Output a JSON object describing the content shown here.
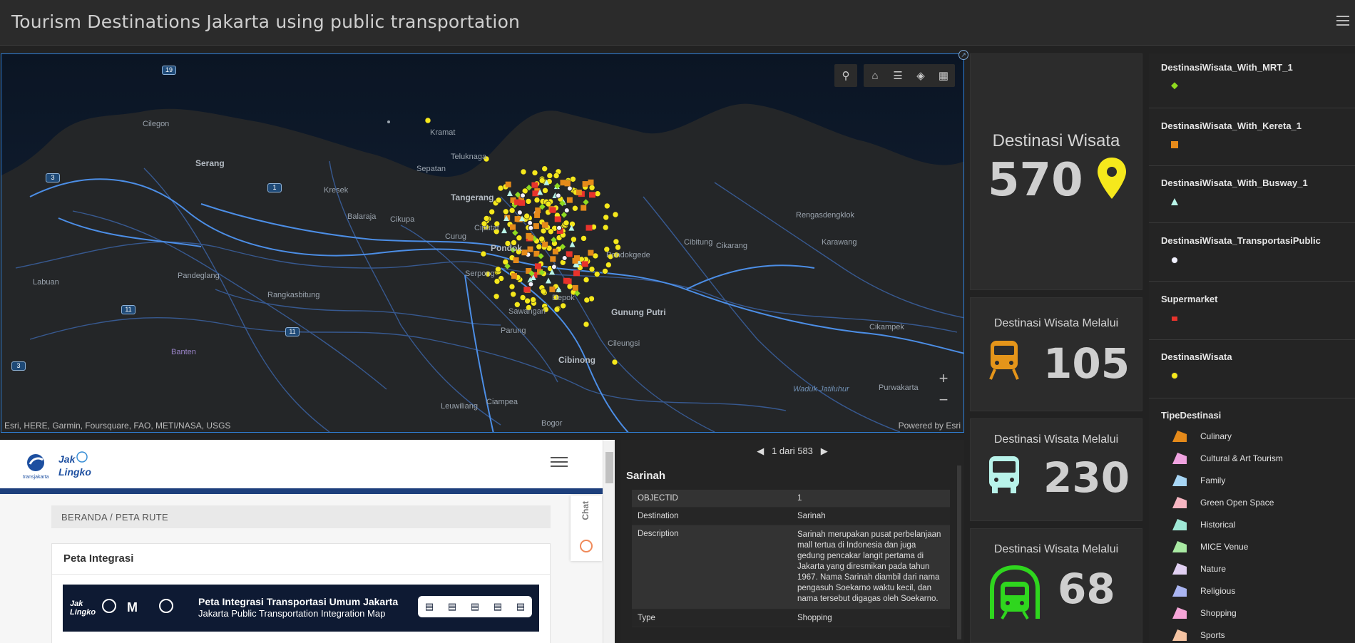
{
  "header": {
    "title": "Tourism Destinations Jakarta using public transportation"
  },
  "map": {
    "attribution": "Esri, HERE, Garmin, Foursquare, FAO, METI/NASA, USGS",
    "powered_by": "Powered by Esri",
    "labels": {
      "cilegon": "Cilegon",
      "serang": "Serang",
      "kramat": "Kramat",
      "sepatan": "Sepatan",
      "teluknaga": "Teluknaga",
      "tangerang": "Tangerang",
      "kresek": "Kresek",
      "balaraja": "Balaraja",
      "cikupa": "Cikupa",
      "curug": "Curug",
      "ciputat": "Ciputat",
      "pondok": "Pondok",
      "pondokgede": "Pondokgede",
      "cibitung": "Cibitung",
      "cikarang": "Cikarang",
      "rengasdengklok": "Rengasdengklok",
      "karawang": "Karawang",
      "labuan": "Labuan",
      "pandeglang": "Pandeglang",
      "rangkasbitung": "Rangkasbitung",
      "serpong": "Serpong",
      "sawangan": "Sawangan",
      "depok": "Depok",
      "gunung_putri": "Gunung Putri",
      "parung": "Parung",
      "cileungsi": "Cileungsi",
      "cibinong": "Cibinong",
      "cikampek": "Cikampek",
      "banten": "Banten",
      "waduk": "Waduk Jatiluhur",
      "purwakarta": "Purwakarta",
      "leuwiliang": "Leuwiliang",
      "ciampea": "Ciampea",
      "bogor": "Bogor"
    },
    "shields": {
      "s19": "19",
      "s3a": "3",
      "s1": "1",
      "s11a": "11",
      "s11b": "11",
      "s3b": "3"
    },
    "toolbar": {
      "search": "search-icon",
      "home": "home-icon",
      "legend": "list-icon",
      "layers": "layers-icon",
      "basemap": "grid-icon"
    },
    "zoom_in": "+",
    "zoom_out": "−"
  },
  "stats": {
    "total": {
      "label": "Destinasi Wisata",
      "value": "570"
    },
    "mrt": {
      "label": "Destinasi Wisata Melalui",
      "value": "105"
    },
    "busway": {
      "label": "Destinasi Wisata Melalui",
      "value": "230"
    },
    "kereta": {
      "label": "Destinasi Wisata Melalui",
      "value": "68"
    }
  },
  "legend": {
    "mrt": "DestinasiWisata_With_MRT_1",
    "kereta": "DestinasiWisata_With_Kereta_1",
    "busway": "DestinasiWisata_With_Busway_1",
    "public": "DestinasiWisata_TransportasiPublic",
    "supermarket": "Supermarket",
    "dest": "DestinasiWisata",
    "tipe": "TipeDestinasi",
    "categories": [
      "Culinary",
      "Cultural & Art Tourism",
      "Family",
      "Green Open Space",
      "Historical",
      "MICE Venue",
      "Nature",
      "Religious",
      "Shopping",
      "Sports"
    ],
    "colors": {
      "mrt": "#8fdb1f",
      "kereta": "#e58a1a",
      "busway": "#b9f5e8",
      "public": "#f2f2ff",
      "supermarket": "#e8332c",
      "dest": "#f5e81c",
      "categories": [
        "#e58a1a",
        "#f0a3e0",
        "#a7d6f5",
        "#f7b6c2",
        "#9fe8d6",
        "#a9eaa3",
        "#e1d0f2",
        "#aab5f2",
        "#f6a5d8",
        "#f5c4a3"
      ]
    }
  },
  "popup": {
    "nav": "1 dari 583",
    "title": "Sarinah",
    "rows": [
      {
        "key": "OBJECTID",
        "val": "1"
      },
      {
        "key": "Destination",
        "val": "Sarinah"
      },
      {
        "key": "Description",
        "val": "Sarinah merupakan pusat perbelanjaan mall tertua di Indonesia dan juga gedung pencakar langit pertama di Jakarta yang diresmikan pada tahun 1967. Nama Sarinah diambil dari nama pengasuh Soekarno waktu kecil, dan nama tersebut digagas oleh Soekarno."
      },
      {
        "key": "Type",
        "val": "Shopping"
      }
    ]
  },
  "web": {
    "breadcrumb": "BERANDA / PETA RUTE",
    "card_title": "Peta Integrasi",
    "banner_title": "Peta Integrasi Transportasi Umum Jakarta",
    "banner_sub": "Jakarta Public Transportation Integration Map",
    "chat": "Chat",
    "logo_text": "Jak Lingko",
    "logo_sub": "transjakarta"
  }
}
